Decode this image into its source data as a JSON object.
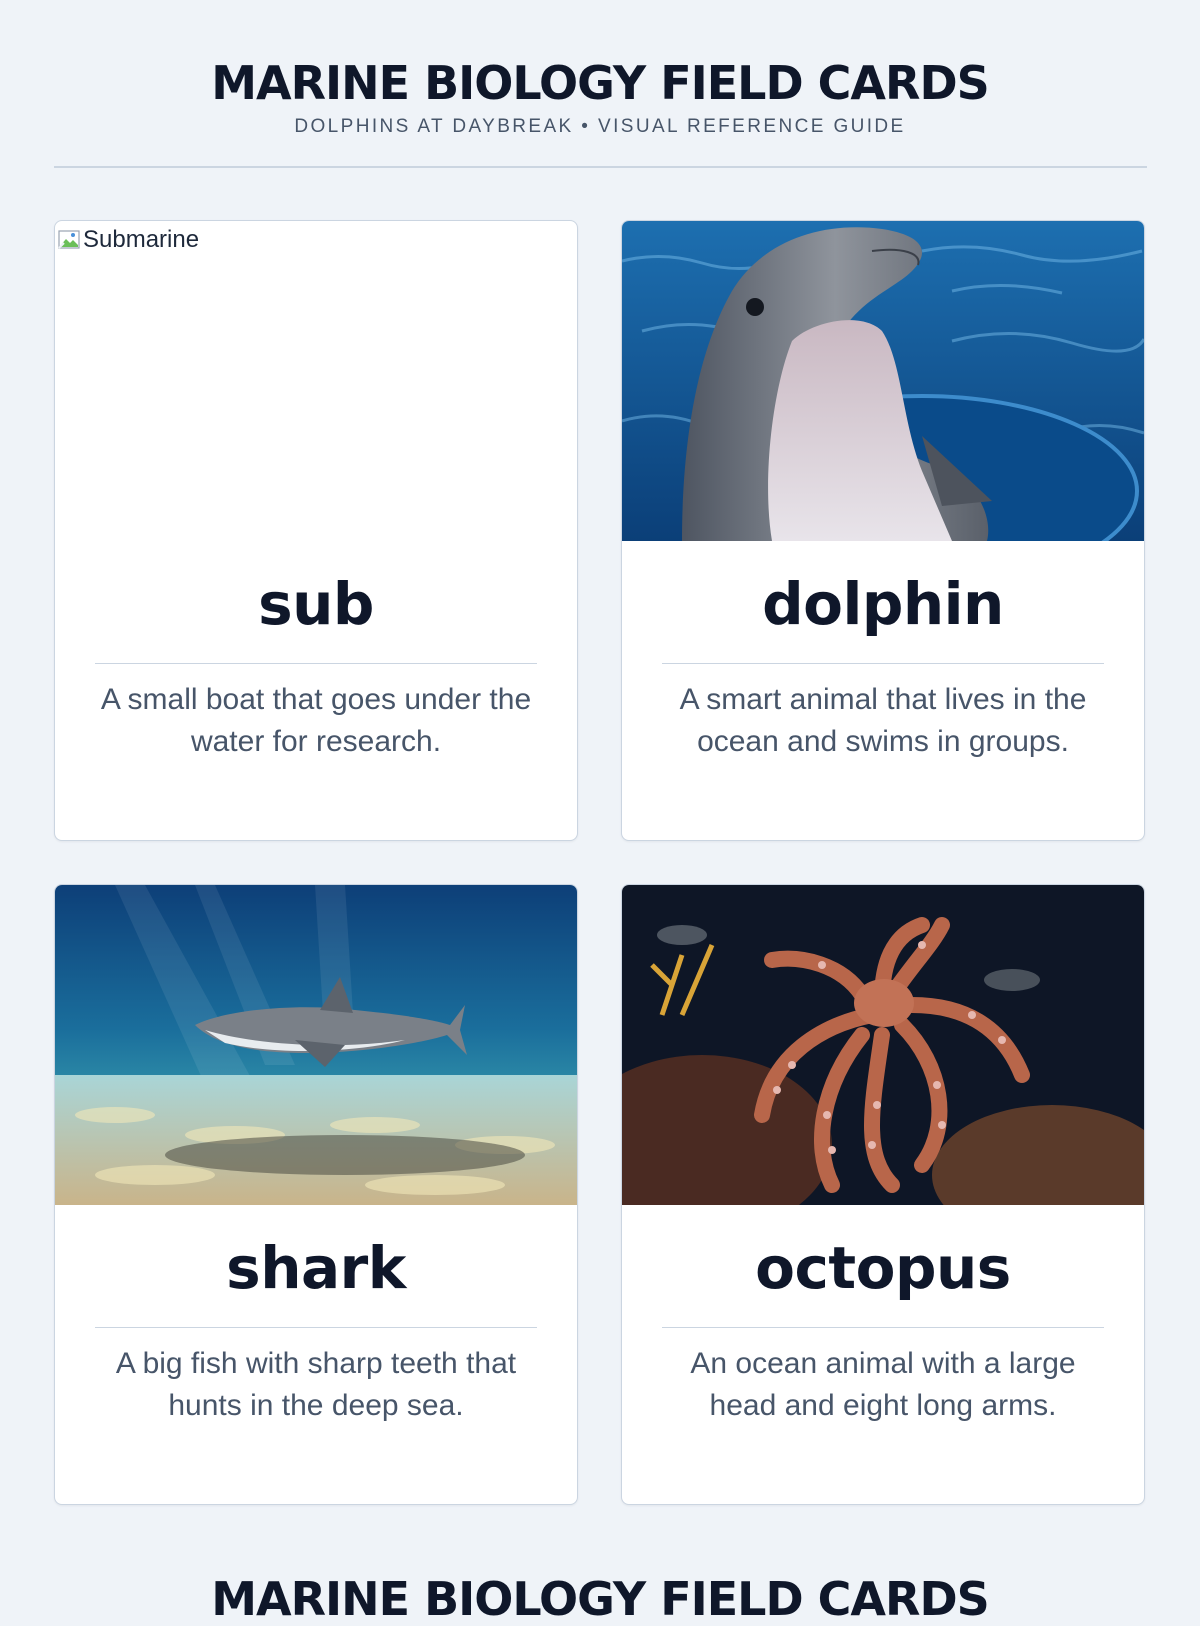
{
  "header": {
    "title": "MARINE BIOLOGY FIELD CARDS",
    "subtitle": "DOLPHINS AT DAYBREAK • VISUAL REFERENCE GUIDE"
  },
  "cards": [
    {
      "term": "sub",
      "definition": "A small boat that goes under the water for research.",
      "image_alt": "Submarine",
      "image_state": "broken-image-icon"
    },
    {
      "term": "dolphin",
      "definition": "A smart animal that lives in the ocean and swims in groups.",
      "image_state": "dolphin-photo"
    },
    {
      "term": "shark",
      "definition": "A big fish with sharp teeth that hunts in the deep sea.",
      "image_state": "shark-photo"
    },
    {
      "term": "octopus",
      "definition": "An ocean animal with a large head and eight long arms.",
      "image_state": "octopus-photo"
    }
  ],
  "footer": {
    "repeated_title": "MARINE BIOLOGY FIELD CARDS"
  },
  "colors": {
    "background": "#eff3f8",
    "card": "#ffffff",
    "border": "#cbd5e1",
    "heading": "#0f172a",
    "body_text": "#475569"
  }
}
